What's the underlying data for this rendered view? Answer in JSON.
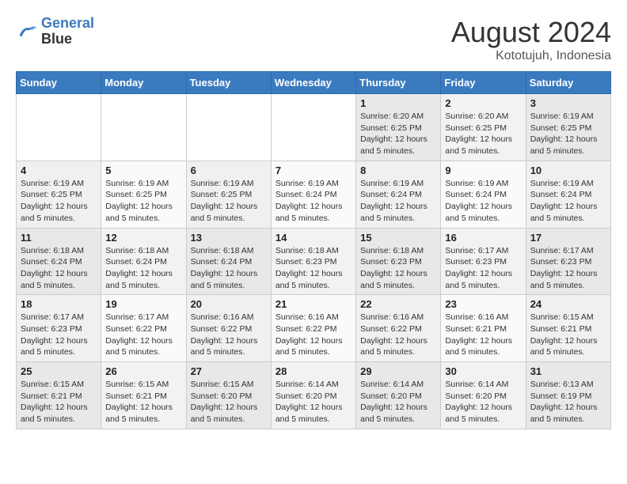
{
  "header": {
    "logo_line1": "General",
    "logo_line2": "Blue",
    "title": "August 2024",
    "subtitle": "Kototujuh, Indonesia"
  },
  "calendar": {
    "days_of_week": [
      "Sunday",
      "Monday",
      "Tuesday",
      "Wednesday",
      "Thursday",
      "Friday",
      "Saturday"
    ],
    "weeks": [
      [
        {
          "day": "",
          "info": ""
        },
        {
          "day": "",
          "info": ""
        },
        {
          "day": "",
          "info": ""
        },
        {
          "day": "",
          "info": ""
        },
        {
          "day": "1",
          "info": "Sunrise: 6:20 AM\nSunset: 6:25 PM\nDaylight: 12 hours\nand 5 minutes."
        },
        {
          "day": "2",
          "info": "Sunrise: 6:20 AM\nSunset: 6:25 PM\nDaylight: 12 hours\nand 5 minutes."
        },
        {
          "day": "3",
          "info": "Sunrise: 6:19 AM\nSunset: 6:25 PM\nDaylight: 12 hours\nand 5 minutes."
        }
      ],
      [
        {
          "day": "4",
          "info": "Sunrise: 6:19 AM\nSunset: 6:25 PM\nDaylight: 12 hours\nand 5 minutes."
        },
        {
          "day": "5",
          "info": "Sunrise: 6:19 AM\nSunset: 6:25 PM\nDaylight: 12 hours\nand 5 minutes."
        },
        {
          "day": "6",
          "info": "Sunrise: 6:19 AM\nSunset: 6:25 PM\nDaylight: 12 hours\nand 5 minutes."
        },
        {
          "day": "7",
          "info": "Sunrise: 6:19 AM\nSunset: 6:24 PM\nDaylight: 12 hours\nand 5 minutes."
        },
        {
          "day": "8",
          "info": "Sunrise: 6:19 AM\nSunset: 6:24 PM\nDaylight: 12 hours\nand 5 minutes."
        },
        {
          "day": "9",
          "info": "Sunrise: 6:19 AM\nSunset: 6:24 PM\nDaylight: 12 hours\nand 5 minutes."
        },
        {
          "day": "10",
          "info": "Sunrise: 6:19 AM\nSunset: 6:24 PM\nDaylight: 12 hours\nand 5 minutes."
        }
      ],
      [
        {
          "day": "11",
          "info": "Sunrise: 6:18 AM\nSunset: 6:24 PM\nDaylight: 12 hours\nand 5 minutes."
        },
        {
          "day": "12",
          "info": "Sunrise: 6:18 AM\nSunset: 6:24 PM\nDaylight: 12 hours\nand 5 minutes."
        },
        {
          "day": "13",
          "info": "Sunrise: 6:18 AM\nSunset: 6:24 PM\nDaylight: 12 hours\nand 5 minutes."
        },
        {
          "day": "14",
          "info": "Sunrise: 6:18 AM\nSunset: 6:23 PM\nDaylight: 12 hours\nand 5 minutes."
        },
        {
          "day": "15",
          "info": "Sunrise: 6:18 AM\nSunset: 6:23 PM\nDaylight: 12 hours\nand 5 minutes."
        },
        {
          "day": "16",
          "info": "Sunrise: 6:17 AM\nSunset: 6:23 PM\nDaylight: 12 hours\nand 5 minutes."
        },
        {
          "day": "17",
          "info": "Sunrise: 6:17 AM\nSunset: 6:23 PM\nDaylight: 12 hours\nand 5 minutes."
        }
      ],
      [
        {
          "day": "18",
          "info": "Sunrise: 6:17 AM\nSunset: 6:23 PM\nDaylight: 12 hours\nand 5 minutes."
        },
        {
          "day": "19",
          "info": "Sunrise: 6:17 AM\nSunset: 6:22 PM\nDaylight: 12 hours\nand 5 minutes."
        },
        {
          "day": "20",
          "info": "Sunrise: 6:16 AM\nSunset: 6:22 PM\nDaylight: 12 hours\nand 5 minutes."
        },
        {
          "day": "21",
          "info": "Sunrise: 6:16 AM\nSunset: 6:22 PM\nDaylight: 12 hours\nand 5 minutes."
        },
        {
          "day": "22",
          "info": "Sunrise: 6:16 AM\nSunset: 6:22 PM\nDaylight: 12 hours\nand 5 minutes."
        },
        {
          "day": "23",
          "info": "Sunrise: 6:16 AM\nSunset: 6:21 PM\nDaylight: 12 hours\nand 5 minutes."
        },
        {
          "day": "24",
          "info": "Sunrise: 6:15 AM\nSunset: 6:21 PM\nDaylight: 12 hours\nand 5 minutes."
        }
      ],
      [
        {
          "day": "25",
          "info": "Sunrise: 6:15 AM\nSunset: 6:21 PM\nDaylight: 12 hours\nand 5 minutes."
        },
        {
          "day": "26",
          "info": "Sunrise: 6:15 AM\nSunset: 6:21 PM\nDaylight: 12 hours\nand 5 minutes."
        },
        {
          "day": "27",
          "info": "Sunrise: 6:15 AM\nSunset: 6:20 PM\nDaylight: 12 hours\nand 5 minutes."
        },
        {
          "day": "28",
          "info": "Sunrise: 6:14 AM\nSunset: 6:20 PM\nDaylight: 12 hours\nand 5 minutes."
        },
        {
          "day": "29",
          "info": "Sunrise: 6:14 AM\nSunset: 6:20 PM\nDaylight: 12 hours\nand 5 minutes."
        },
        {
          "day": "30",
          "info": "Sunrise: 6:14 AM\nSunset: 6:20 PM\nDaylight: 12 hours\nand 5 minutes."
        },
        {
          "day": "31",
          "info": "Sunrise: 6:13 AM\nSunset: 6:19 PM\nDaylight: 12 hours\nand 5 minutes."
        }
      ]
    ]
  }
}
